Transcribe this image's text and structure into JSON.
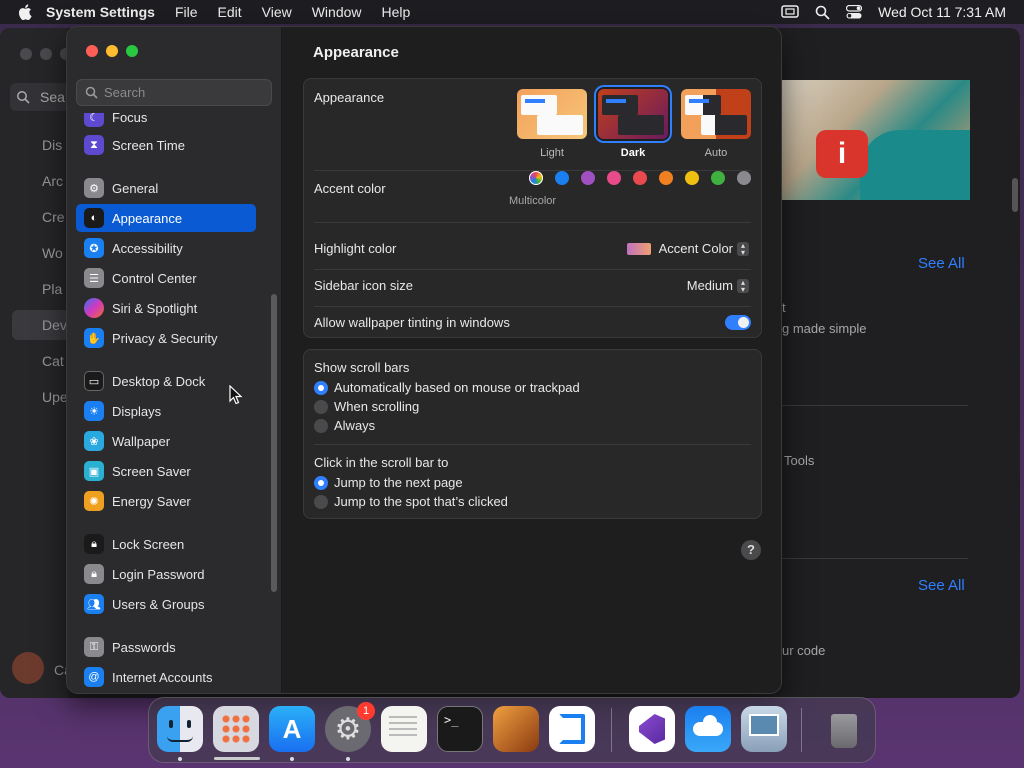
{
  "menubar": {
    "app_name": "System Settings",
    "menus": [
      "File",
      "Edit",
      "View",
      "Window",
      "Help"
    ],
    "clock": "Wed Oct 11  7:31 AM"
  },
  "background_app": {
    "search_label": "Sea",
    "sidebar_items": [
      "Dis",
      "Arc",
      "Cre",
      "Wo",
      "Pla",
      "Dev",
      "Cat",
      "Upe"
    ],
    "selected_item": "Dev",
    "bottom_label": "Ca",
    "see_all_1": "See All",
    "see_all_2": "See All",
    "text_t": "t",
    "text_made_simple": "g made simple",
    "text_tools": "Tools",
    "text_code": "ur code"
  },
  "sidebar": {
    "search_placeholder": "Search",
    "items": [
      {
        "label": "Focus",
        "icon": "moon-icon",
        "color": "#5e4ad0"
      },
      {
        "label": "Screen Time",
        "icon": "hourglass-icon",
        "color": "#5e4ad0"
      },
      {
        "label": "General",
        "icon": "gear-icon",
        "color": "#8a8a8e"
      },
      {
        "label": "Appearance",
        "icon": "appearance-icon",
        "color": "#1a1a1a"
      },
      {
        "label": "Accessibility",
        "icon": "accessibility-icon",
        "color": "#1a7ff0"
      },
      {
        "label": "Control Center",
        "icon": "control-center-icon",
        "color": "#8a8a8e"
      },
      {
        "label": "Siri & Spotlight",
        "icon": "siri-icon",
        "color": "#c03ad0"
      },
      {
        "label": "Privacy & Security",
        "icon": "hand-icon",
        "color": "#1a7ff0"
      },
      {
        "label": "Desktop & Dock",
        "icon": "dock-icon",
        "color": "#1a1a1a"
      },
      {
        "label": "Displays",
        "icon": "sun-icon",
        "color": "#1a7ff0"
      },
      {
        "label": "Wallpaper",
        "icon": "wallpaper-icon",
        "color": "#2aa8e0"
      },
      {
        "label": "Screen Saver",
        "icon": "screensaver-icon",
        "color": "#2ab0d0"
      },
      {
        "label": "Energy Saver",
        "icon": "bulb-icon",
        "color": "#f0a020"
      },
      {
        "label": "Lock Screen",
        "icon": "lock-icon",
        "color": "#1a1a1a"
      },
      {
        "label": "Login Password",
        "icon": "login-lock-icon",
        "color": "#8a8a8e"
      },
      {
        "label": "Users & Groups",
        "icon": "users-icon",
        "color": "#1a7ff0"
      },
      {
        "label": "Passwords",
        "icon": "key-icon",
        "color": "#8a8a8e"
      },
      {
        "label": "Internet Accounts",
        "icon": "at-icon",
        "color": "#1a7ff0"
      }
    ]
  },
  "content": {
    "title": "Appearance",
    "appearance_label": "Appearance",
    "modes": [
      "Light",
      "Dark",
      "Auto"
    ],
    "selected_mode": "Dark",
    "accent_label": "Accent color",
    "accent_colors": [
      "#ffffff",
      "#1a7ff0",
      "#a050c0",
      "#e84a8a",
      "#e84a50",
      "#f08020",
      "#f0c010",
      "#40b040",
      "#8a8a8e"
    ],
    "accent_caption": "Multicolor",
    "highlight_label": "Highlight color",
    "highlight_value": "Accent Color",
    "sidebar_icon_label": "Sidebar icon size",
    "sidebar_icon_value": "Medium",
    "tinting_label": "Allow wallpaper tinting in windows",
    "tinting_on": true,
    "scrollbars_label": "Show scroll bars",
    "scrollbar_options": [
      "Automatically based on mouse or trackpad",
      "When scrolling",
      "Always"
    ],
    "click_label": "Click in the scroll bar to",
    "click_options": [
      "Jump to the next page",
      "Jump to the spot that’s clicked"
    ],
    "help": "?"
  },
  "dock": {
    "apps": [
      "Finder",
      "Launchpad",
      "App Store",
      "System Settings",
      "TextEdit",
      "Terminal",
      "GarageBand",
      "Visual Studio Code",
      "Visual Studio",
      "Weather",
      "Preview",
      "Trash"
    ],
    "badge_count": "1"
  }
}
